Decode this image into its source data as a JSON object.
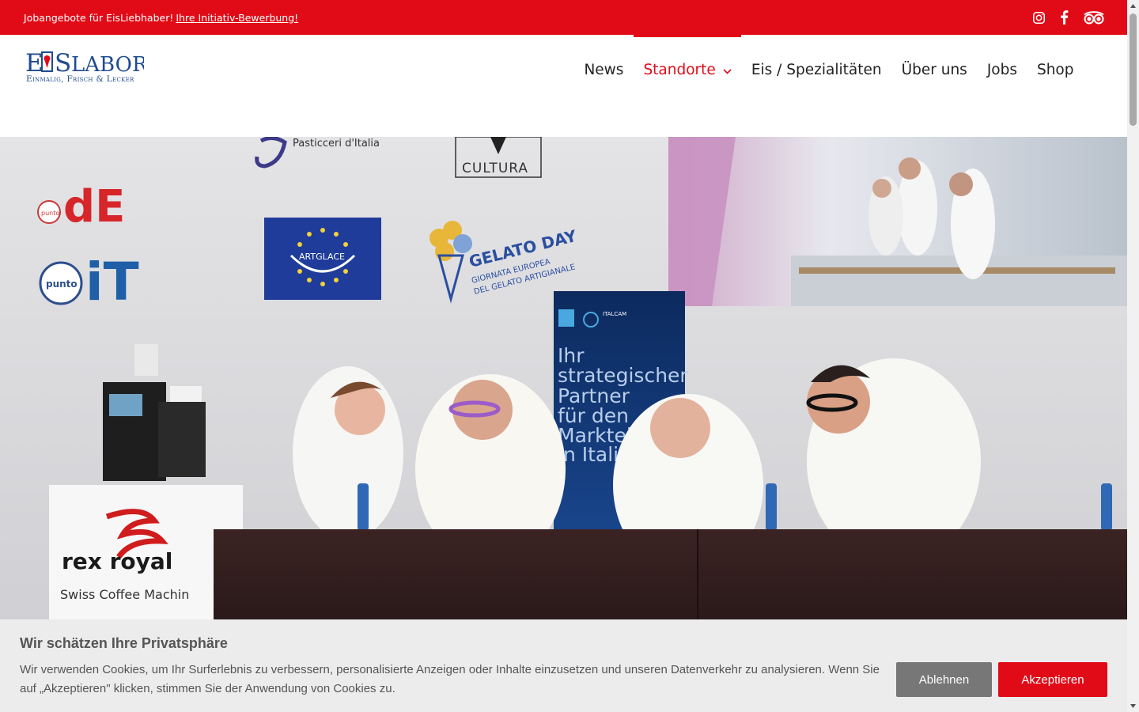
{
  "topbar": {
    "text": "Jobangebote für EisLiebhaber!",
    "link": "Ihre Initiativ-Bewerbung!",
    "social_icons": [
      "instagram-icon",
      "facebook-icon",
      "tripadvisor-icon"
    ]
  },
  "logo": {
    "main": "EISLABOR",
    "tagline": "Einmalig, Frisch & Lecker"
  },
  "nav": {
    "items": [
      {
        "label": "News"
      },
      {
        "label": "Standorte",
        "active": true,
        "dropdown": true
      },
      {
        "label": "Eis / Spezialitäten"
      },
      {
        "label": "Über uns"
      },
      {
        "label": "Jobs"
      },
      {
        "label": "Shop"
      }
    ]
  },
  "hero": {
    "banner_texts": {
      "pasticceri": "Pasticceri d'Italia",
      "cultura": "CULTURA",
      "de": "dE",
      "it": "iT",
      "puntode": "punto",
      "puntoit": "punto",
      "artglace": "ARTGLACE",
      "gelatoday": "GELATO DAY",
      "gelatoday_sub1": "GIORNATA EUROPEA",
      "gelatoday_sub2": "DEL GELATO ARTIGIANALE",
      "italcam": "ITALCAM",
      "rollup_lines": [
        "Ihr",
        "strategischer",
        "Partner",
        "für den",
        "Markteinstieg",
        "in Italien"
      ],
      "rexroyal": "rex royal",
      "rexroyal_sub": "Swiss Coffee Machin"
    }
  },
  "cookie": {
    "title": "Wir schätzen Ihre Privatsphäre",
    "text": "Wir verwenden Cookies, um Ihr Surferlebnis zu verbessern, personalisierte Anzeigen oder Inhalte einzusetzen und unseren Datenverkehr zu analysieren. Wenn Sie auf „Akzeptieren\" klicken, stimmen Sie der Anwendung von Cookies zu.",
    "decline": "Ablehnen",
    "accept": "Akzeptieren"
  },
  "colors": {
    "brand_red": "#e10b17",
    "logo_blue": "#1f4b8f",
    "cookie_bg": "#ececec",
    "decline_bg": "#777777"
  }
}
